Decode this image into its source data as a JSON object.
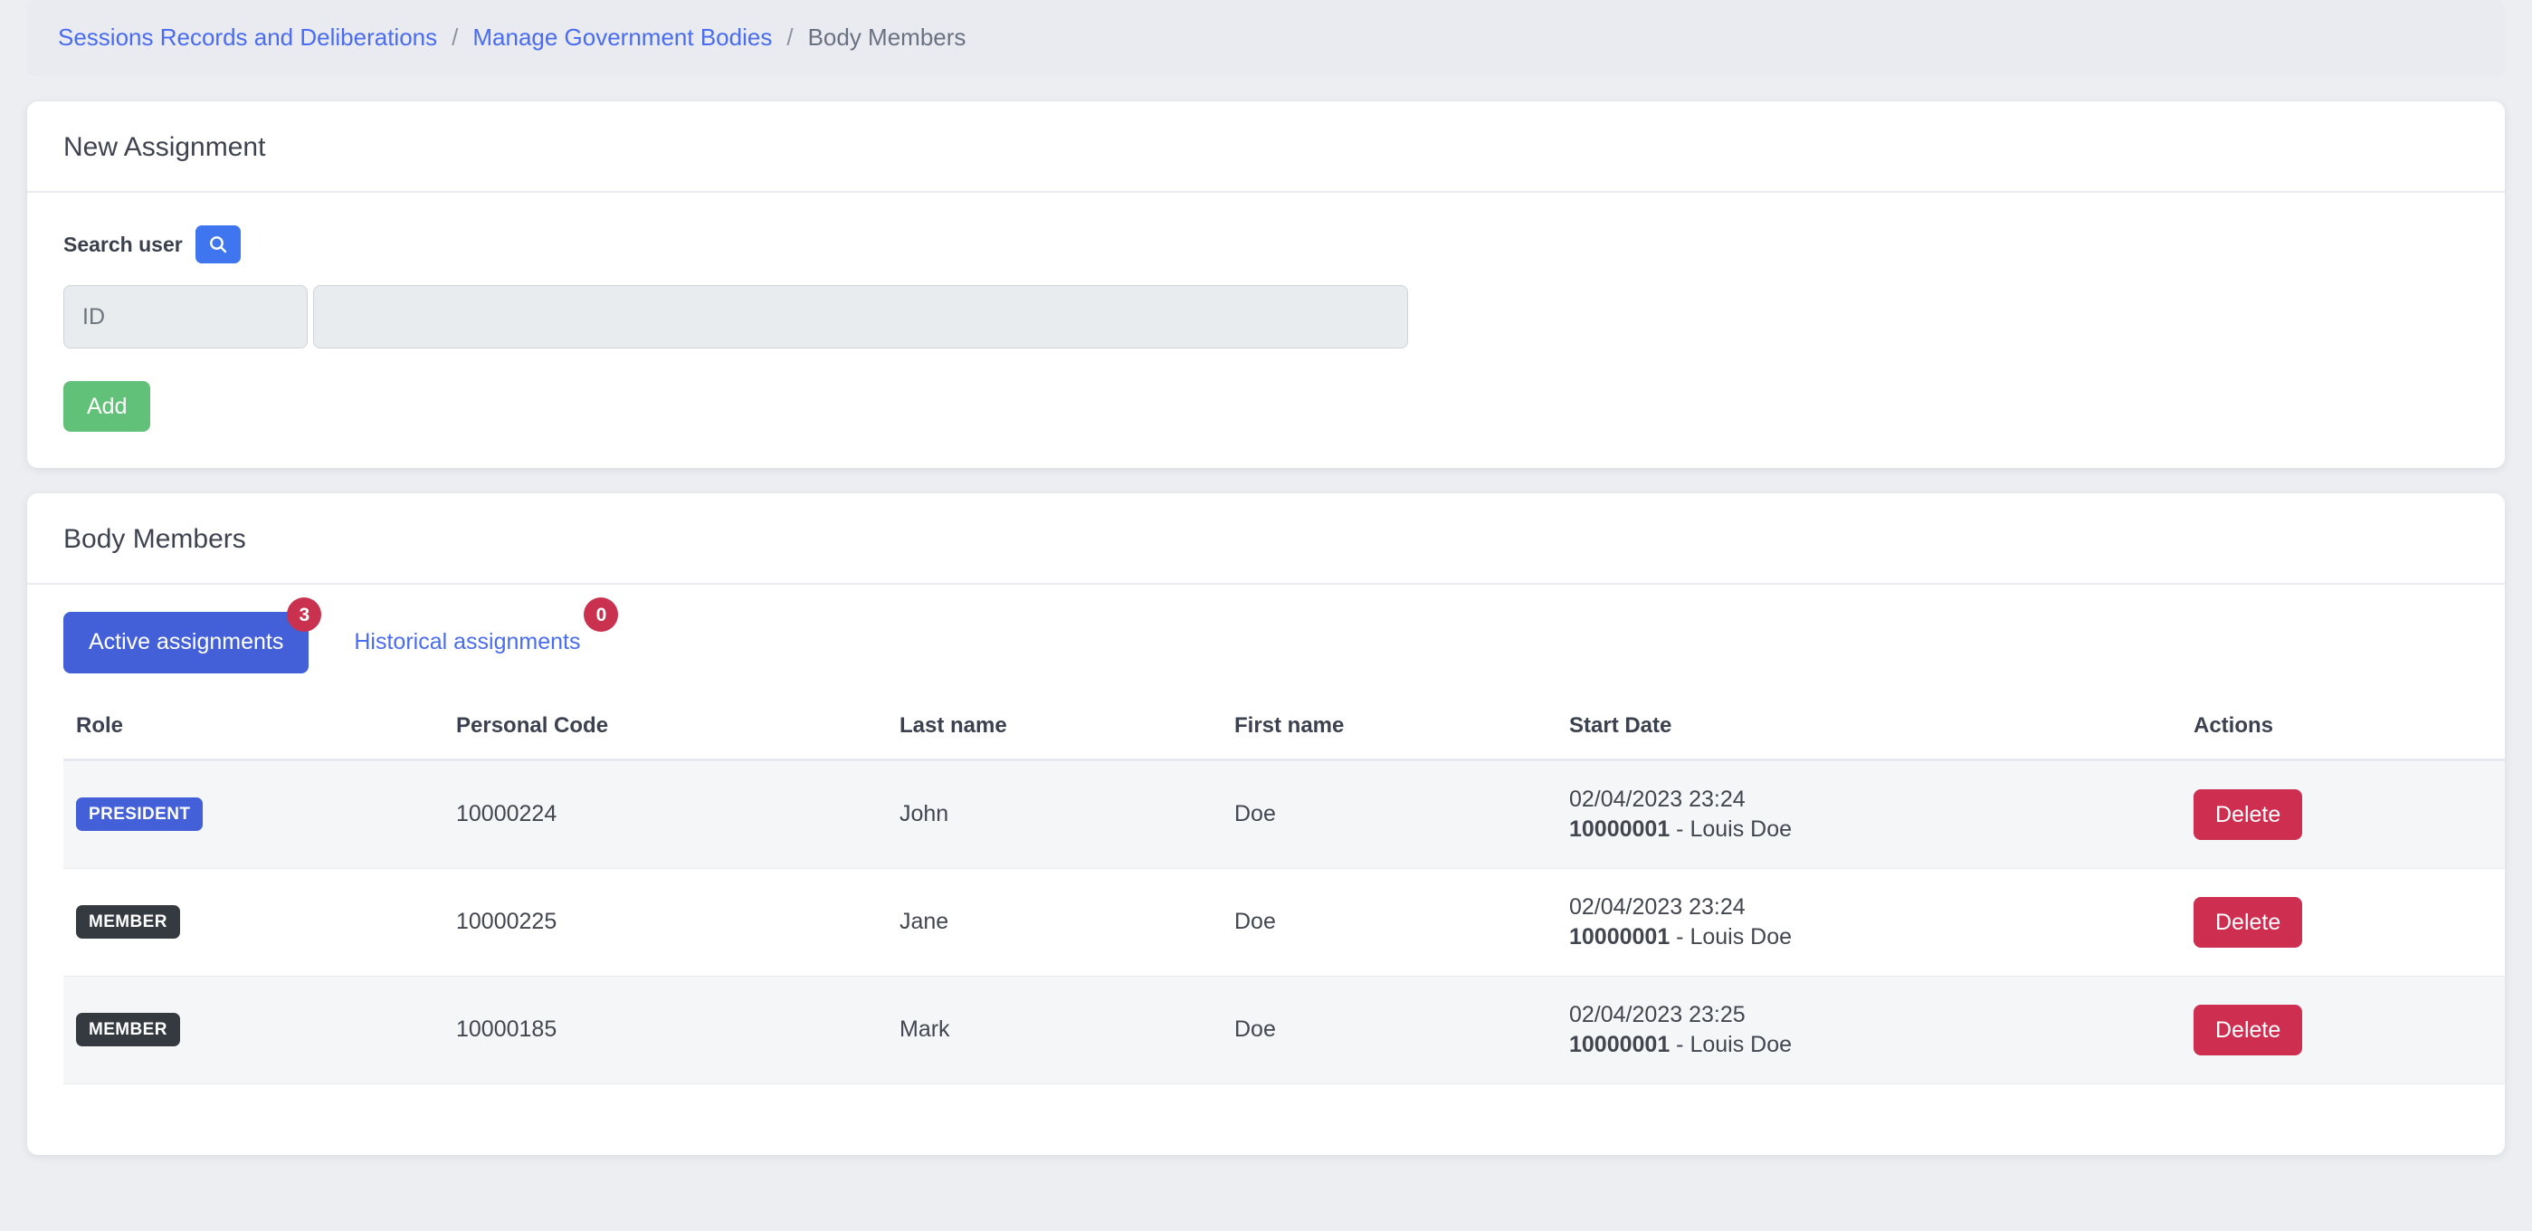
{
  "breadcrumb": {
    "items": [
      {
        "label": "Sessions Records and Deliberations",
        "current": false
      },
      {
        "label": "Manage Government Bodies",
        "current": false
      },
      {
        "label": "Body Members",
        "current": true
      }
    ],
    "separator": "/"
  },
  "new_assignment": {
    "title": "New Assignment",
    "search_label": "Search user",
    "search_icon": "search-icon",
    "id_field": {
      "value": "",
      "placeholder": "ID"
    },
    "name_field": {
      "value": "",
      "placeholder": ""
    },
    "add_label": "Add"
  },
  "body_members": {
    "title": "Body Members",
    "tabs": [
      {
        "label": "Active assignments",
        "badge": "3",
        "active": true
      },
      {
        "label": "Historical assignments",
        "badge": "0",
        "active": false
      }
    ],
    "table": {
      "columns": [
        "Role",
        "Personal Code",
        "Last name",
        "First name",
        "Start Date",
        "Actions"
      ],
      "rows": [
        {
          "role": "PRESIDENT",
          "role_variant": "president",
          "personal_code": "10000224",
          "last_name": "John",
          "first_name": "Doe",
          "start_date": "02/04/2023 23:24",
          "actor_code": "10000001",
          "actor_sep": " - ",
          "actor_name": "Louis Doe",
          "action_label": "Delete"
        },
        {
          "role": "MEMBER",
          "role_variant": "member",
          "personal_code": "10000225",
          "last_name": "Jane",
          "first_name": "Doe",
          "start_date": "02/04/2023 23:24",
          "actor_code": "10000001",
          "actor_sep": " - ",
          "actor_name": "Louis Doe",
          "action_label": "Delete"
        },
        {
          "role": "MEMBER",
          "role_variant": "member",
          "personal_code": "10000185",
          "last_name": "Mark",
          "first_name": "Doe",
          "start_date": "02/04/2023 23:25",
          "actor_code": "10000001",
          "actor_sep": " - ",
          "actor_name": "Louis Doe",
          "action_label": "Delete"
        }
      ]
    }
  },
  "colors": {
    "page_bg": "#eceef2",
    "link": "#4a6cf0",
    "primary": "#4460d8",
    "search_blue": "#3f76f0",
    "success": "#62c178",
    "danger": "#ce2f51",
    "badge": "#c9314e",
    "dark": "#343a40"
  }
}
